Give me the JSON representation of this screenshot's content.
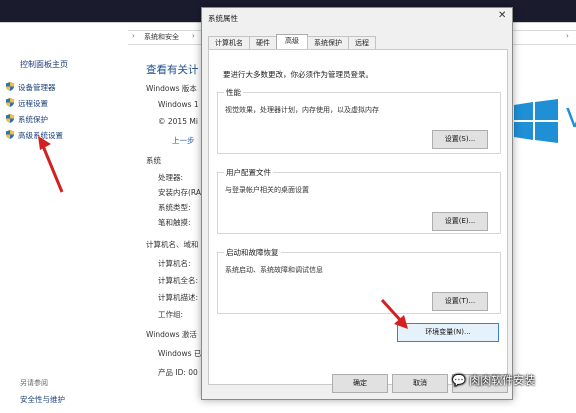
{
  "control_panel": {
    "breadcrumb": "系统和安全",
    "sidebar": {
      "title": "控制面板主页",
      "items": [
        {
          "label": "设备管理器"
        },
        {
          "label": "远程设置"
        },
        {
          "label": "系统保护"
        },
        {
          "label": "高级系统设置"
        }
      ],
      "see_also": "另请参阅",
      "security": "安全性与维护"
    },
    "heading": "查看有关计",
    "edition_label": "Windows 版本",
    "edition_name": "Windows 1",
    "copyright": "© 2015 Mi",
    "more_link": "上一步",
    "system_label": "系统",
    "processor": "处理器:",
    "ram": "安装内存(RA",
    "system_type": "系统类型:",
    "pen_touch": "笔和触摸:",
    "computer_section": "计算机名、域和",
    "computer_name": "计算机名:",
    "full_name": "计算机全名:",
    "description": "计算机描述:",
    "workgroup": "工作组:",
    "activation": "Windows 激活",
    "activation_status": "Windows 已",
    "product_id": "产品 ID: 00",
    "windows_letter": "V"
  },
  "dialog": {
    "title": "系统属性",
    "close": "✕",
    "tabs": [
      "计算机名",
      "硬件",
      "高级",
      "系统保护",
      "远程"
    ],
    "active_tab": "高级",
    "admin_note": "要进行大多数更改，你必须作为管理员登录。",
    "performance": {
      "label": "性能",
      "desc": "视觉效果，处理器计划，内存使用，以及虚拟内存",
      "button": "设置(S)..."
    },
    "user_profiles": {
      "label": "用户配置文件",
      "desc": "与登录帐户相关的桌面设置",
      "button": "设置(E)..."
    },
    "startup": {
      "label": "启动和故障恢复",
      "desc": "系统启动、系统故障和调试信息",
      "button": "设置(T)..."
    },
    "env_button": "环境变量(N)...",
    "ok": "确定",
    "cancel": "取消",
    "apply": "应用"
  },
  "watermark": "肉肉软件安装",
  "colors": {
    "arrow": "#d42020",
    "accent": "#1f8fd6",
    "title_bar": "#1b1b2e"
  }
}
